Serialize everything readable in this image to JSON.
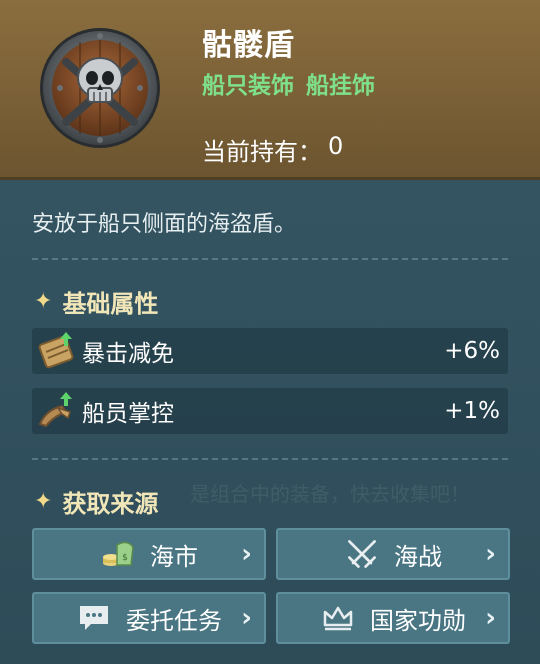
{
  "item": {
    "name": "骷髅盾",
    "tags": [
      "船只装饰",
      "船挂饰"
    ],
    "owned_label": "当前持有：",
    "owned_count": "0",
    "icon": "pirate-skull-shield-icon"
  },
  "description": "安放于船只侧面的海盗盾。",
  "attributes": {
    "title": "基础属性",
    "star": "✦",
    "items": [
      {
        "label": "暴击减免",
        "value": "+6%",
        "icon": "crit-reduction-icon"
      },
      {
        "label": "船员掌控",
        "value": "+1%",
        "icon": "crew-control-icon"
      }
    ]
  },
  "sources": {
    "title": "获取来源",
    "star": "✦",
    "faint_text": "是组合中的装备，快去收集吧！",
    "buttons": [
      {
        "label": "海市",
        "icon": "market-coins-icon"
      },
      {
        "label": "海战",
        "icon": "crossed-swords-icon"
      },
      {
        "label": "委托任务",
        "icon": "chat-bubble-icon"
      },
      {
        "label": "国家功勋",
        "icon": "crown-icon"
      }
    ],
    "chevron": "›"
  },
  "colors": {
    "header_bg": "#7a6036",
    "body_bg": "#2f4c59",
    "tag_green": "#7fe08a",
    "section_gold": "#f1e6b8",
    "button_bg": "#4a7684"
  }
}
